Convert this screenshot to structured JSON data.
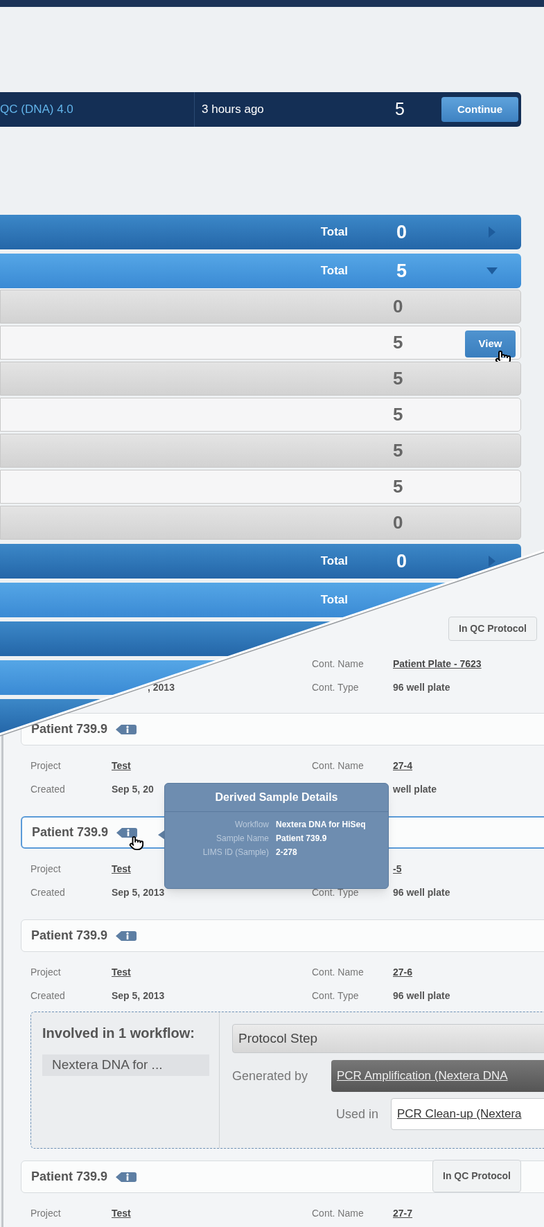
{
  "active_row": {
    "name": "QC (DNA) 4.0",
    "time": "3 hours ago",
    "count": "5",
    "button": "Continue"
  },
  "groups": [
    {
      "kind": "bar",
      "label": "Total",
      "count": "0",
      "expanded": false
    },
    {
      "kind": "bar",
      "label": "Total",
      "count": "5",
      "expanded": true,
      "children": [
        {
          "count": "0"
        },
        {
          "count": "5",
          "button": "View",
          "hovered": true
        },
        {
          "count": "5"
        },
        {
          "count": "5"
        },
        {
          "count": "5"
        },
        {
          "count": "5"
        },
        {
          "count": "0"
        }
      ]
    },
    {
      "kind": "bar",
      "label": "Total",
      "count": "0",
      "expanded": false
    },
    {
      "kind": "bar",
      "label": "Total"
    },
    {
      "kind": "bar"
    },
    {
      "kind": "bar"
    },
    {
      "kind": "bar"
    }
  ],
  "detail_panel": {
    "top_badge": "In QC Protocol",
    "partial_created": ", 2013",
    "partial_fields": [
      {
        "label": "Cont. Name",
        "value": "Patient Plate - 7623",
        "link": true
      },
      {
        "label": "Cont. Type",
        "value": "96 well plate",
        "link": false
      }
    ],
    "samples": [
      {
        "name": "Patient 739.9",
        "highlighted": false,
        "fields": [
          {
            "label": "Project",
            "value": "Test",
            "link": true
          },
          {
            "label": "Cont. Name",
            "value": "27-4",
            "link": true
          },
          {
            "label": "Created",
            "value": "Sep 5, 20",
            "link": false
          },
          {
            "value": "well plate",
            "link": false
          }
        ]
      },
      {
        "name": "Patient 739.9",
        "highlighted": true,
        "fields": [
          {
            "label": "Project",
            "value": "Test",
            "link": true
          },
          {
            "value": "-5",
            "link": true
          },
          {
            "label": "Created",
            "value": "Sep 5, 2013",
            "link": false
          },
          {
            "label": "Cont. Type",
            "value": "96 well plate",
            "link": false
          }
        ]
      },
      {
        "name": "Patient 739.9",
        "highlighted": false,
        "fields": [
          {
            "label": "Project",
            "value": "Test",
            "link": true
          },
          {
            "label": "Cont. Name",
            "value": "27-6",
            "link": true
          },
          {
            "label": "Created",
            "value": "Sep 5, 2013",
            "link": false
          },
          {
            "label": "Cont. Type",
            "value": "96 well plate",
            "link": false
          }
        ],
        "workflow": {
          "title": "Involved in 1 workflow:",
          "name": "Nextera DNA for ...",
          "step": "Protocol Step",
          "generated_label": "Generated by",
          "generated_value": "PCR Amplification (Nextera DNA",
          "used_label": "Used in",
          "used_value": "PCR Clean-up (Nextera"
        }
      },
      {
        "name": "Patient 739.9",
        "highlighted": false,
        "badge": "In QC Protocol",
        "fields": [
          {
            "label": "Project",
            "value": "Test",
            "link": true
          },
          {
            "label": "Cont. Name",
            "value": "27-7",
            "link": true
          }
        ]
      }
    ],
    "tooltip": {
      "title": "Derived Sample Details",
      "rows": [
        {
          "label": "Workflow",
          "value": "Nextera DNA for HiSeq"
        },
        {
          "label": "Sample Name",
          "value": "Patient 739.9"
        },
        {
          "label": "LIMS ID (Sample)",
          "value": "2-278"
        }
      ]
    }
  }
}
